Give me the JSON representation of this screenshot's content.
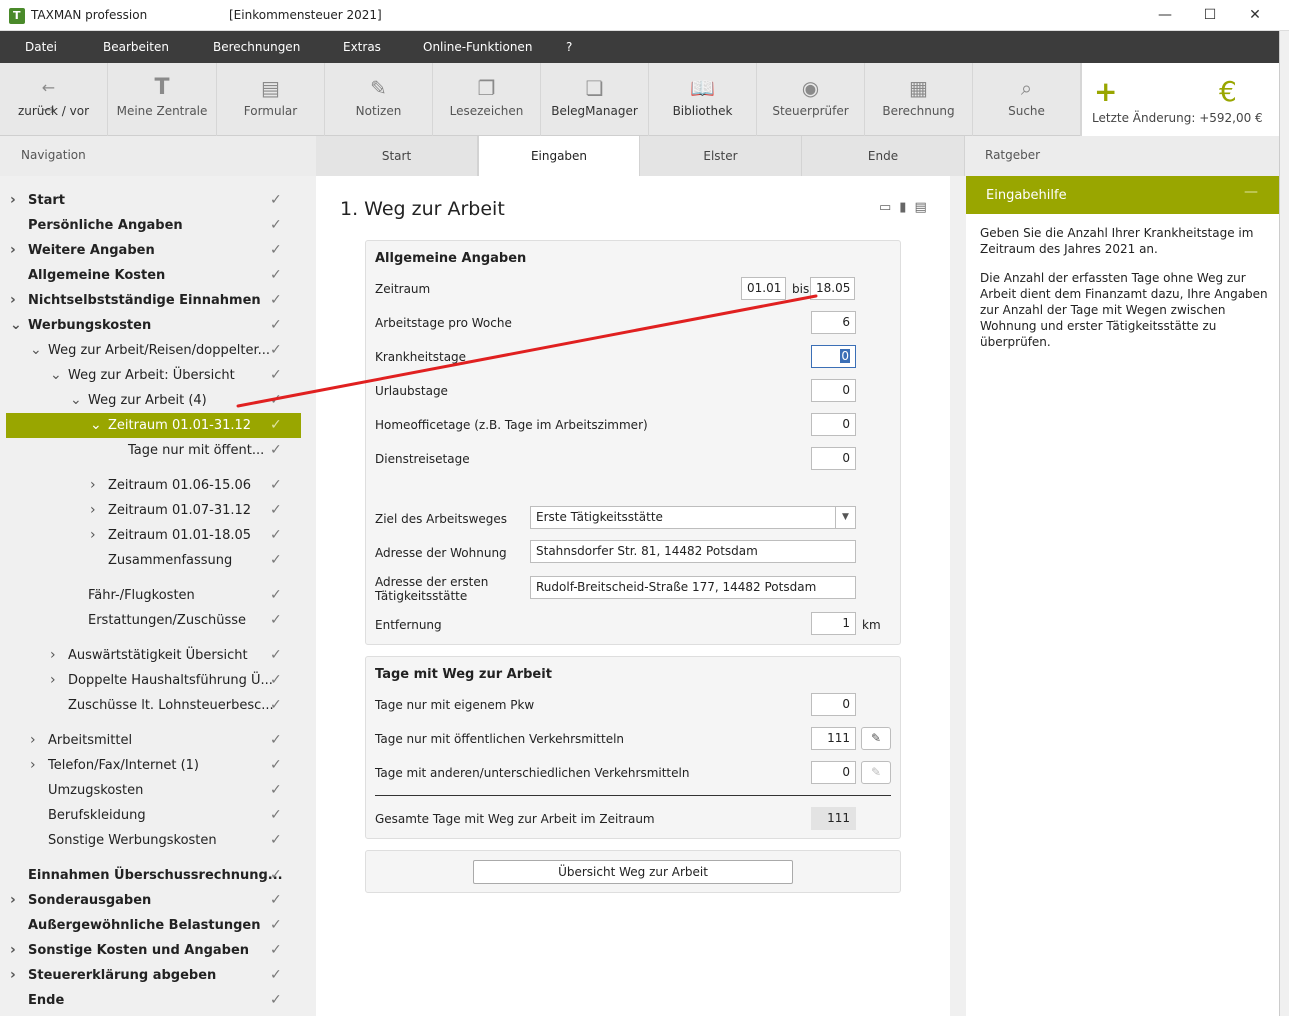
{
  "window": {
    "app_name": "TAXMAN professional",
    "doc_title": "[Einkommensteuer 2021]",
    "minimize": "—",
    "maximize": "☐",
    "close": "✕"
  },
  "menu": [
    "Datei",
    "Bearbeiten",
    "Berechnungen",
    "Extras",
    "Online-Funktionen",
    "?"
  ],
  "toolbar": {
    "back_forward": "zurück / vor",
    "meine_zentrale": "Meine Zentrale",
    "formular": "Formular",
    "notizen": "Notizen",
    "lesezeichen": "Lesezeichen",
    "belegmanager": "BelegManager",
    "bibliothek": "Bibliothek",
    "steuerpruefer": "Steuerprüfer",
    "berechnung": "Berechnung",
    "suche": "Suche",
    "last_change": "Letzte Änderung: +592,00 €",
    "plus": "+",
    "euro": "€"
  },
  "tabs": {
    "navigation": "Navigation",
    "start": "Start",
    "eingaben": "Eingaben",
    "elster": "Elster",
    "ende": "Ende",
    "ratgeber": "Ratgeber"
  },
  "nav": [
    {
      "label": "Start",
      "bold": true,
      "chevron": "›",
      "indent": 0
    },
    {
      "label": "Persönliche Angaben",
      "bold": true,
      "chevron": "",
      "indent": 0
    },
    {
      "label": "Weitere Angaben",
      "bold": true,
      "chevron": "›",
      "indent": 0
    },
    {
      "label": "Allgemeine Kosten",
      "bold": true,
      "chevron": "",
      "indent": 0
    },
    {
      "label": "Nichtselbstständige Einnahmen",
      "bold": true,
      "chevron": "›",
      "indent": 0
    },
    {
      "label": "Werbungskosten",
      "bold": true,
      "chevron": "⌄",
      "indent": 0
    },
    {
      "label": "Weg zur Arbeit/Reisen/doppelter...",
      "bold": false,
      "chevron": "⌄",
      "indent": 1
    },
    {
      "label": "Weg zur Arbeit: Übersicht",
      "bold": false,
      "chevron": "⌄",
      "indent": 2
    },
    {
      "label": "Weg zur Arbeit (4)",
      "bold": false,
      "chevron": "⌄",
      "indent": 3
    },
    {
      "label": "Zeitraum 01.01-31.12",
      "bold": false,
      "chevron": "⌄",
      "indent": 4,
      "selected": true
    },
    {
      "label": "Tage nur mit öffent...",
      "bold": false,
      "chevron": "",
      "indent": 5
    },
    {
      "label": "Zeitraum 01.06-15.06",
      "bold": false,
      "chevron": "›",
      "indent": 4
    },
    {
      "label": "Zeitraum 01.07-31.12",
      "bold": false,
      "chevron": "›",
      "indent": 4
    },
    {
      "label": "Zeitraum 01.01-18.05",
      "bold": false,
      "chevron": "›",
      "indent": 4
    },
    {
      "label": "Zusammenfassung",
      "bold": false,
      "chevron": "",
      "indent": 4
    },
    {
      "label": "Fähr-/Flugkosten",
      "bold": false,
      "chevron": "",
      "indent": 3
    },
    {
      "label": "Erstattungen/Zuschüsse",
      "bold": false,
      "chevron": "",
      "indent": 3
    },
    {
      "label": "Auswärtstätigkeit Übersicht",
      "bold": false,
      "chevron": "›",
      "indent": 2
    },
    {
      "label": "Doppelte Haushaltsführung Ü...",
      "bold": false,
      "chevron": "›",
      "indent": 2
    },
    {
      "label": "Zuschüsse lt. Lohnsteuerbesc...",
      "bold": false,
      "chevron": "",
      "indent": 2
    },
    {
      "label": "Arbeitsmittel",
      "bold": false,
      "chevron": "›",
      "indent": 1
    },
    {
      "label": "Telefon/Fax/Internet (1)",
      "bold": false,
      "chevron": "›",
      "indent": 1
    },
    {
      "label": "Umzugskosten",
      "bold": false,
      "chevron": "",
      "indent": 1
    },
    {
      "label": "Berufskleidung",
      "bold": false,
      "chevron": "",
      "indent": 1
    },
    {
      "label": "Sonstige Werbungskosten",
      "bold": false,
      "chevron": "",
      "indent": 1
    },
    {
      "label": "Einnahmen Überschussrechnung...",
      "bold": true,
      "chevron": "",
      "indent": 0
    },
    {
      "label": "Sonderausgaben",
      "bold": true,
      "chevron": "›",
      "indent": 0
    },
    {
      "label": "Außergewöhnliche Belastungen",
      "bold": true,
      "chevron": "",
      "indent": 0
    },
    {
      "label": "Sonstige Kosten und Angaben",
      "bold": true,
      "chevron": "›",
      "indent": 0
    },
    {
      "label": "Steuererklärung abgeben",
      "bold": true,
      "chevron": "›",
      "indent": 0
    },
    {
      "label": "Ende",
      "bold": true,
      "chevron": "",
      "indent": 0
    }
  ],
  "page": {
    "title": "1. Weg zur Arbeit",
    "allgemein": {
      "heading": "Allgemeine Angaben",
      "zeitraum_label": "Zeitraum",
      "zeitraum_from": "01.01",
      "bis": "bis",
      "zeitraum_to": "18.05",
      "arbeitstage_label": "Arbeitstage pro Woche",
      "arbeitstage_value": "6",
      "krankheitstage_label": "Krankheitstage",
      "krankheitstage_value": "0",
      "urlaubstage_label": "Urlaubstage",
      "urlaubstage_value": "0",
      "homeoffice_label": "Homeofficetage (z.B. Tage im Arbeitszimmer)",
      "homeoffice_value": "0",
      "dienstreise_label": "Dienstreisetage",
      "dienstreise_value": "0",
      "ziel_label": "Ziel des Arbeitsweges",
      "ziel_value": "Erste Tätigkeitsstätte",
      "wohnung_label": "Adresse der Wohnung",
      "wohnung_value": "Stahnsdorfer Str. 81, 14482 Potsdam",
      "taetigkeit_label_1": "Adresse der ersten",
      "taetigkeit_label_2": "Tätigkeitsstätte",
      "taetigkeit_value": "Rudolf-Breitscheid-Straße 177, 14482 Potsdam",
      "entfernung_label": "Entfernung",
      "entfernung_value": "1",
      "entfernung_unit": "km"
    },
    "tage": {
      "heading": "Tage mit Weg zur Arbeit",
      "pkw_label": "Tage nur mit eigenem Pkw",
      "pkw_value": "0",
      "oev_label": "Tage nur mit öffentlichen Verkehrsmitteln",
      "oev_value": "111",
      "andere_label": "Tage mit anderen/unterschiedlichen Verkehrsmitteln",
      "andere_value": "0",
      "gesamt_label": "Gesamte Tage mit Weg zur Arbeit im Zeitraum",
      "gesamt_value": "111"
    },
    "uebersicht_button": "Übersicht Weg zur Arbeit"
  },
  "help": {
    "heading": "Eingabehilfe",
    "minus": "—",
    "p1": "Geben Sie die Anzahl Ihrer Krankheitstage im Zeitraum des Jahres 2021 an.",
    "p2": "Die Anzahl der erfassten Tage ohne Weg zur Arbeit dient dem Finanzamt dazu, Ihre Angaben zur Anzahl der Tage mit Wegen zwischen Wohnung und erster Tätigkeitsstätte zu überprüfen."
  },
  "colors": {
    "accent": "#99a600",
    "menubar": "#3c3c3c",
    "annotation_line": "#e02020"
  }
}
